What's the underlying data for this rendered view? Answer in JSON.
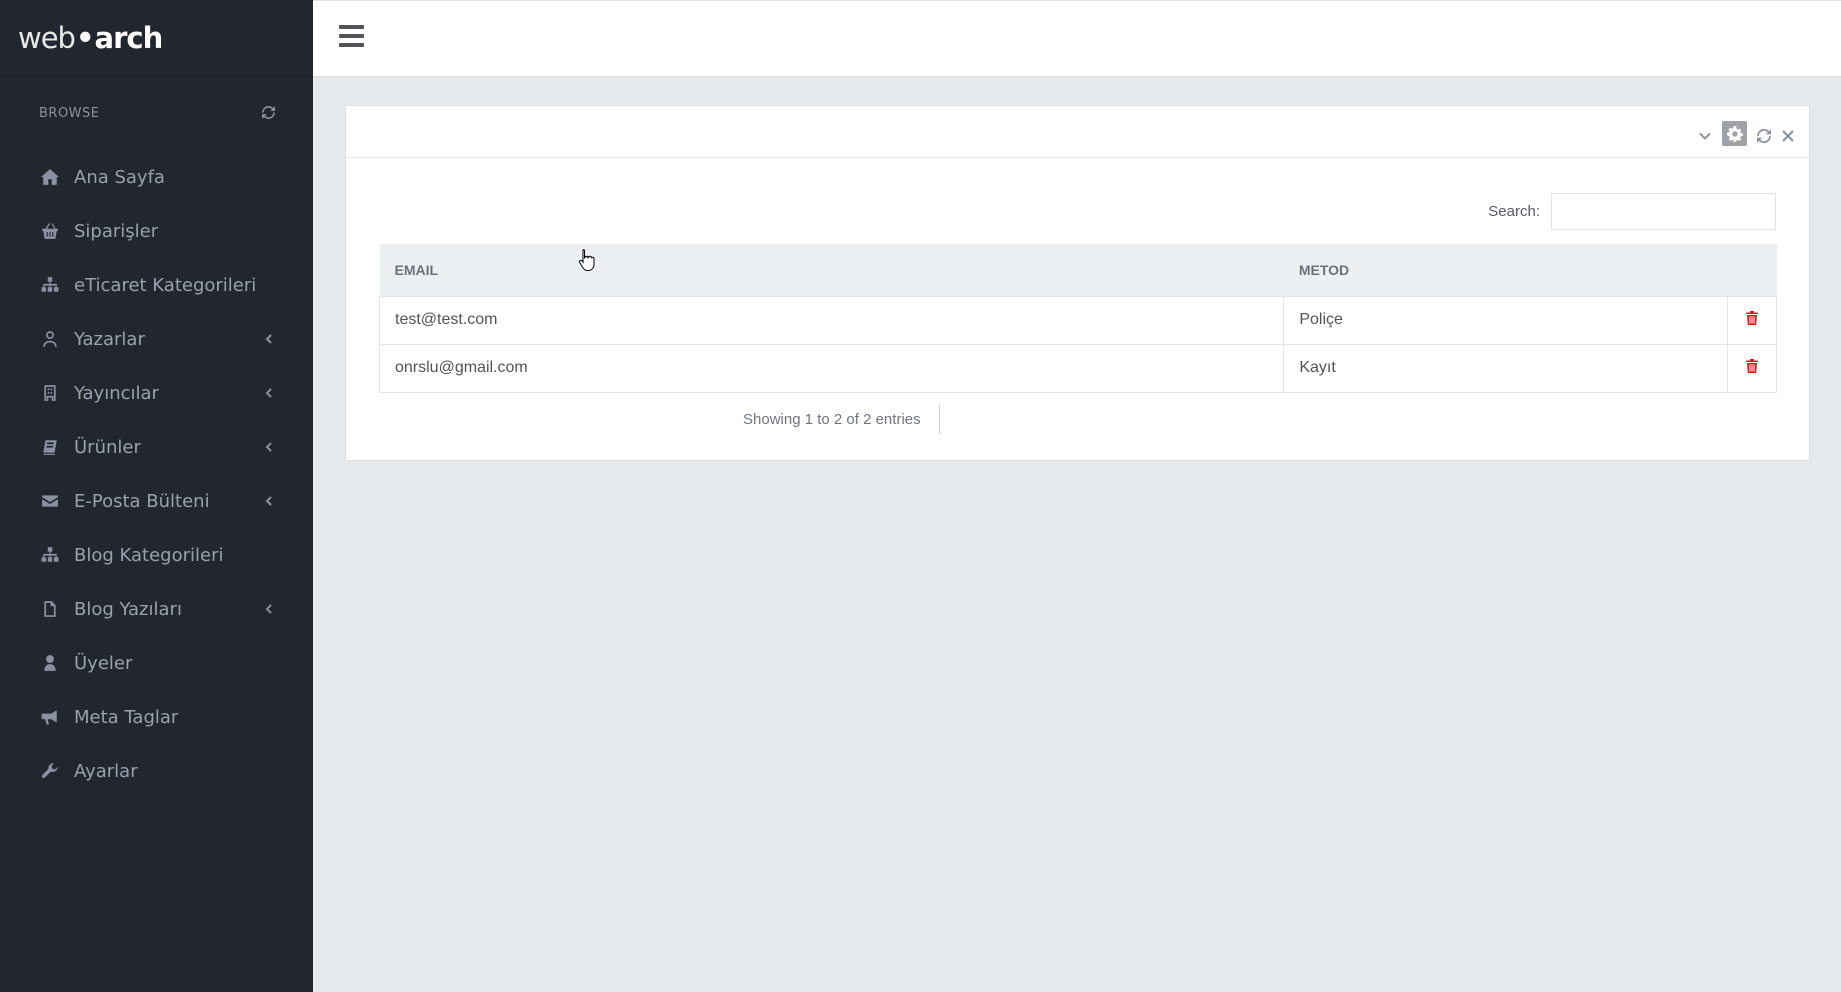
{
  "logo": {
    "part1": "web",
    "dot": "•",
    "part2": "arch"
  },
  "sidebar": {
    "browse_label": "BROWSE",
    "items": [
      {
        "label": "Ana Sayfa",
        "icon": "home-icon",
        "has_arrow": false
      },
      {
        "label": "Siparişler",
        "icon": "basket-icon",
        "has_arrow": false
      },
      {
        "label": "eTicaret Kategorileri",
        "icon": "sitemap-icon",
        "has_arrow": false
      },
      {
        "label": "Yazarlar",
        "icon": "user-outline-icon",
        "has_arrow": true
      },
      {
        "label": "Yayıncılar",
        "icon": "building-icon",
        "has_arrow": true
      },
      {
        "label": "Ürünler",
        "icon": "book-icon",
        "has_arrow": true
      },
      {
        "label": "E-Posta Bülteni",
        "icon": "envelope-icon",
        "has_arrow": true
      },
      {
        "label": "Blog Kategorileri",
        "icon": "sitemap-icon",
        "has_arrow": false
      },
      {
        "label": "Blog Yazıları",
        "icon": "file-icon",
        "has_arrow": true
      },
      {
        "label": "Üyeler",
        "icon": "user-icon",
        "has_arrow": false
      },
      {
        "label": "Meta Taglar",
        "icon": "bullhorn-icon",
        "has_arrow": false
      },
      {
        "label": "Ayarlar",
        "icon": "wrench-icon",
        "has_arrow": false
      }
    ]
  },
  "search": {
    "label": "Search:",
    "value": "",
    "placeholder": ""
  },
  "table": {
    "headers": {
      "email": "EMAIL",
      "metod": "METOD"
    },
    "rows": [
      {
        "email": "test@test.com",
        "metod": "Poliçe"
      },
      {
        "email": "onrslu@gmail.com",
        "metod": "Kayıt"
      }
    ]
  },
  "info": "Showing 1 to 2 of 2 entries",
  "colors": {
    "sidebar_bg": "#22262e",
    "page_bg": "#e5e9ec",
    "delete": "#e41b23"
  }
}
